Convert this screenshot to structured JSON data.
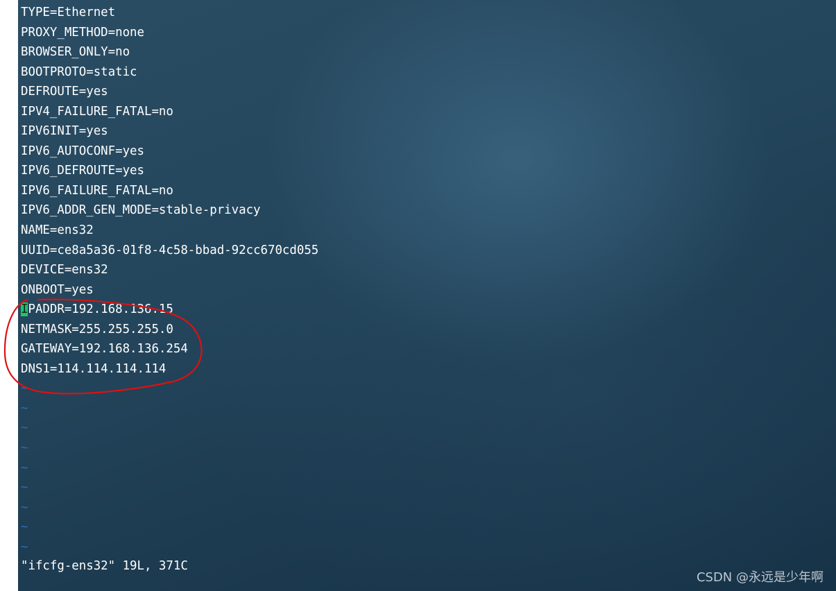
{
  "file_lines": [
    "TYPE=Ethernet",
    "PROXY_METHOD=none",
    "BROWSER_ONLY=no",
    "BOOTPROTO=static",
    "DEFROUTE=yes",
    "IPV4_FAILURE_FATAL=no",
    "IPV6INIT=yes",
    "IPV6_AUTOCONF=yes",
    "IPV6_DEFROUTE=yes",
    "IPV6_FAILURE_FATAL=no",
    "IPV6_ADDR_GEN_MODE=stable-privacy",
    "NAME=ens32",
    "UUID=ce8a5a36-01f8-4c58-bbad-92cc670cd055",
    "DEVICE=ens32",
    "ONBOOT=yes"
  ],
  "cursor_line": {
    "cursor_char": "I",
    "rest": "PADDR=192.168.136.15"
  },
  "highlighted_lines": [
    "NETMASK=255.255.255.0",
    "GATEWAY=192.168.136.254",
    "DNS1=114.114.114.114"
  ],
  "empty_line_marker": "~",
  "empty_lines_count": 9,
  "status_line": "\"ifcfg-ens32\" 19L, 371C",
  "watermark": "CSDN @永远是少年啊",
  "colors": {
    "text": "#ffffff",
    "tilde": "#2f6db4",
    "cursor": "#22c26a",
    "annotation_circle": "#e01010"
  }
}
